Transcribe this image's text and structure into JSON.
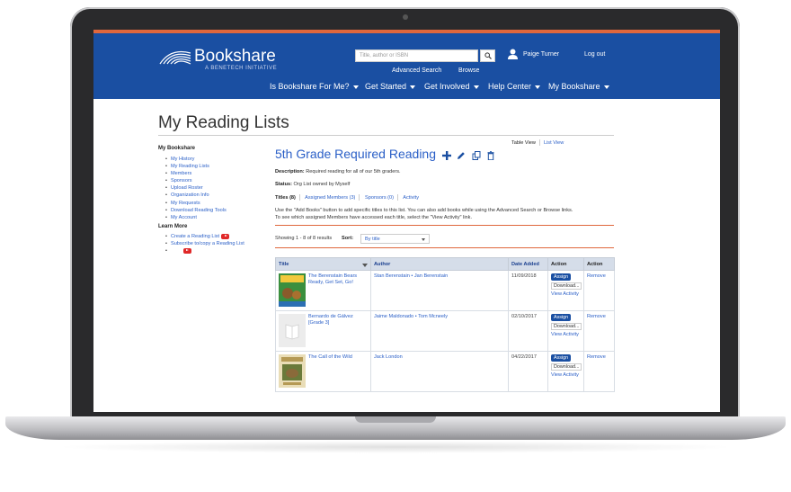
{
  "header": {
    "logo_name": "Bookshare",
    "logo_tagline": "A BENETECH INITIATIVE",
    "search_placeholder": "Title, author or ISBN",
    "user_name": "Paige Turner",
    "logout": "Log out",
    "advanced_search": "Advanced Search",
    "browse": "Browse",
    "nav": [
      "Is Bookshare For Me?",
      "Get Started",
      "Get Involved",
      "Help Center",
      "My Bookshare"
    ],
    "accent_color": "#1a4fa2",
    "stripe_color": "#e0673d"
  },
  "page_title": "My Reading Lists",
  "sidebar": {
    "heading": "My Bookshare",
    "items": [
      "My History",
      "My Reading Lists",
      "Members",
      "Sponsors",
      "Upload Roster",
      "Organization Info",
      "My Requests",
      "Download Reading Tools",
      "My Account"
    ],
    "learn_heading": "Learn More",
    "learn_items": [
      "Create a Reading List",
      "Subscribe to/copy a Reading List"
    ]
  },
  "view_toggle": {
    "table": "Table View",
    "list": "List View"
  },
  "list": {
    "title": "5th Grade Required Reading",
    "description_label": "Description:",
    "description": "Required reading for all of our 5th graders.",
    "status_label": "Status:",
    "status": "Org List owned by Myself",
    "tabs": [
      "Titles (8)",
      "Assigned Members (3)",
      "Sponsors (0)",
      "Activity"
    ],
    "help_text_1": "Use the \"Add Books\" button to add specific titles to this list. You can also add books while using the Advanced Search or Browse links.",
    "help_text_2": "To see which assigned Members have accessed each title, select the \"View Activity\" link.",
    "showing": "Showing 1 - 8 of 8 results",
    "sort_label": "Sort:",
    "sort_value": "By title"
  },
  "table": {
    "headers": [
      "Title",
      "Author",
      "Date Added",
      "Action",
      "Action"
    ],
    "rows": [
      {
        "title": "The Berenstain Bears Ready, Get Set, Go!",
        "author": "Stan Berenstain • Jan Berenstain",
        "date": "11/09/2018",
        "cover": "berenstain"
      },
      {
        "title": "Bernardo de Gálvez [Grade 3]",
        "author": "Jaime Maldonado • Tom Mcneely",
        "date": "02/10/2017",
        "cover": "blank"
      },
      {
        "title": "The Call of the Wild",
        "author": "Jack London",
        "date": "04/22/2017",
        "cover": "callwild"
      }
    ],
    "assign": "Assign",
    "download": "Download...",
    "view_activity": "View Activity",
    "remove": "Remove"
  }
}
